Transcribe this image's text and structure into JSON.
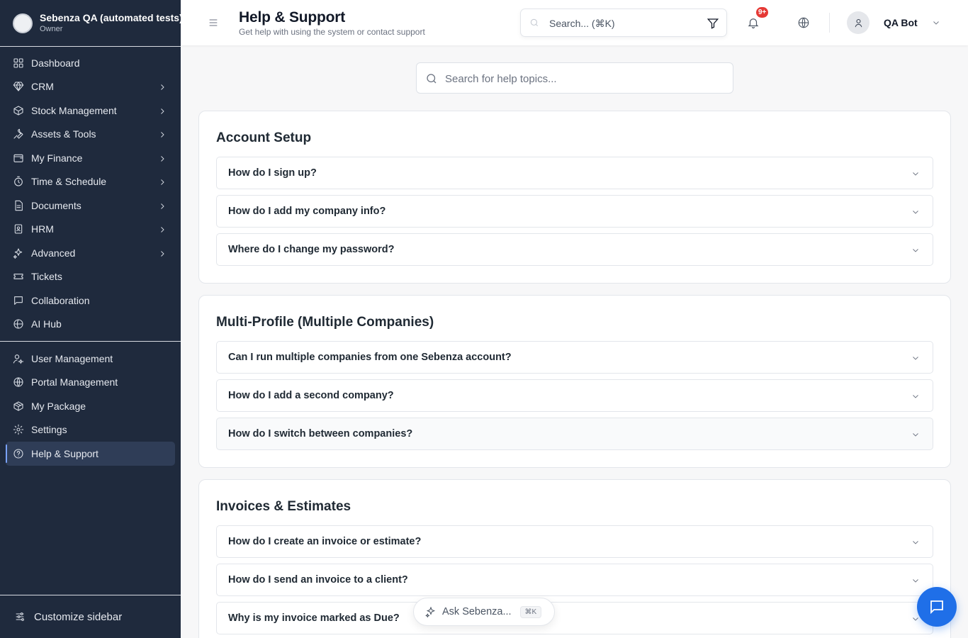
{
  "org": {
    "name": "Sebenza QA (automated tests)",
    "role": "Owner"
  },
  "sidebar": {
    "items": [
      {
        "label": "Dashboard",
        "icon": "dashboard-icon",
        "chevron": false
      },
      {
        "label": "CRM",
        "icon": "diamond-icon",
        "chevron": true
      },
      {
        "label": "Stock Management",
        "icon": "box-icon",
        "chevron": true
      },
      {
        "label": "Assets & Tools",
        "icon": "wrench-icon",
        "chevron": true
      },
      {
        "label": "My Finance",
        "icon": "wallet-icon",
        "chevron": true
      },
      {
        "label": "Time & Schedule",
        "icon": "stopwatch-icon",
        "chevron": true
      },
      {
        "label": "Documents",
        "icon": "document-icon",
        "chevron": true
      },
      {
        "label": "HRM",
        "icon": "id-badge-icon",
        "chevron": true
      },
      {
        "label": "Advanced",
        "icon": "sparkles-icon",
        "chevron": true
      },
      {
        "label": "Tickets",
        "icon": "ticket-icon",
        "chevron": false
      },
      {
        "label": "Collaboration",
        "icon": "chat-icon",
        "chevron": false
      },
      {
        "label": "AI Hub",
        "icon": "ai-hub-icon",
        "chevron": false
      }
    ],
    "admin_items": [
      {
        "label": "User Management",
        "icon": "user-cog-icon"
      },
      {
        "label": "Portal Management",
        "icon": "globe-icon"
      },
      {
        "label": "My Package",
        "icon": "package-icon"
      },
      {
        "label": "Settings",
        "icon": "gear-icon"
      },
      {
        "label": "Help & Support",
        "icon": "help-circle-icon",
        "active": true
      }
    ],
    "footer_label": "Customize sidebar"
  },
  "header": {
    "title": "Help & Support",
    "subtitle": "Get help with using the system or contact support",
    "search_placeholder": "Search... (⌘K)",
    "notification_badge": "9+",
    "user_name": "QA Bot"
  },
  "help_search": {
    "placeholder": "Search for help topics..."
  },
  "sections": [
    {
      "title": "Account Setup",
      "questions": [
        "How do I sign up?",
        "How do I add my company info?",
        "Where do I change my password?"
      ]
    },
    {
      "title": "Multi-Profile (Multiple Companies)",
      "questions": [
        "Can I run multiple companies from one Sebenza account?",
        "How do I add a second company?",
        "How do I switch between companies?"
      ]
    },
    {
      "title": "Invoices & Estimates",
      "questions": [
        "How do I create an invoice or estimate?",
        "How do I send an invoice to a client?",
        "Why is my invoice marked as Due?"
      ]
    }
  ],
  "assistant": {
    "label": "Ask Sebenza...",
    "shortcut": "⌘K"
  },
  "colors": {
    "sidebar_bg": "#1f2a3d",
    "accent": "#1f6fe8",
    "badge": "#e53935"
  }
}
